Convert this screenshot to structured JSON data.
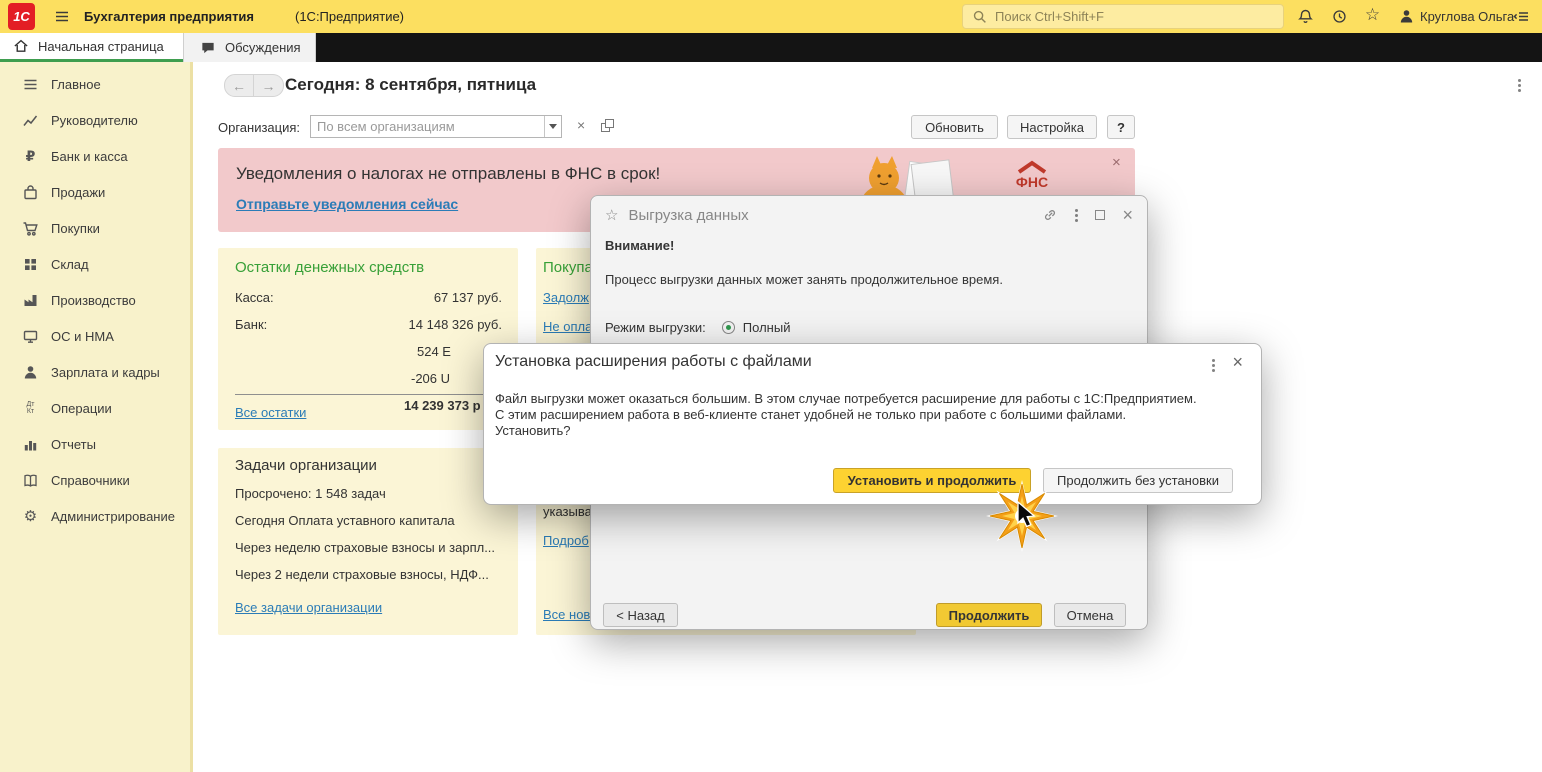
{
  "topbar": {
    "logo": "1С",
    "app_title": "Бухгалтерия предприятия",
    "app_subtitle": "(1С:Предприятие)",
    "search_placeholder": "Поиск Ctrl+Shift+F",
    "user_name": "Круглова Ольга"
  },
  "tabs": {
    "home": "Начальная страница",
    "discussions": "Обсуждения"
  },
  "sidebar": {
    "items": [
      {
        "label": "Главное"
      },
      {
        "label": "Руководителю"
      },
      {
        "label": "Банк и касса"
      },
      {
        "label": "Продажи"
      },
      {
        "label": "Покупки"
      },
      {
        "label": "Склад"
      },
      {
        "label": "Производство"
      },
      {
        "label": "ОС и НМА"
      },
      {
        "label": "Зарплата и кадры"
      },
      {
        "label": "Операции"
      },
      {
        "label": "Отчеты"
      },
      {
        "label": "Справочники"
      },
      {
        "label": "Администрирование"
      }
    ]
  },
  "main": {
    "date_heading": "Сегодня: 8 сентября, пятница",
    "organization": {
      "label": "Организация:",
      "value": "По всем организациям"
    },
    "toolbar": {
      "refresh": "Обновить",
      "settings": "Настройка",
      "help": "?"
    },
    "notification": {
      "title": "Уведомления о налогах не отправлены в ФНС в срок!",
      "link": "Отправьте уведомления сейчас",
      "fns": "ФНС"
    },
    "cash_panel": {
      "title": "Остатки денежных средств",
      "rows": [
        {
          "label": "Касса:",
          "value": "67 137 руб."
        },
        {
          "label": "Банк:",
          "value": "14 148 326 руб."
        },
        {
          "value": "524 E"
        },
        {
          "value": "-206 U"
        }
      ],
      "link": "Все остатки",
      "total": "14 239 373 р"
    },
    "tasks_panel": {
      "title": "Задачи организации",
      "rows": [
        "Просрочено: 1 548 задач",
        "Сегодня Оплата уставного капитала",
        "Через неделю страховые взносы и зарпл...",
        "Через 2 недели страховые взносы, НДФ..."
      ],
      "link": "Все задачи организации"
    },
    "purchases_panel": {
      "title": "Покупа",
      "link1": "Задолж",
      "link2": "Не опла",
      "text1": "указыва",
      "link3": "Подроб",
      "link4": "Все нов"
    }
  },
  "export_dialog": {
    "title": "Выгрузка данных",
    "attention": "Внимание!",
    "message": "Процесс выгрузки данных может занять продолжительное время.",
    "mode_label": "Режим выгрузки:",
    "mode_option": "Полный",
    "back": "< Назад",
    "continue": "Продолжить",
    "cancel": "Отмена"
  },
  "extension_dialog": {
    "title": "Установка расширения работы с файлами",
    "line1": "Файл выгрузки может оказаться большим. В этом случае потребуется расширение для работы с 1С:Предприятием.",
    "line2": "С этим расширением работа в веб-клиенте станет удобней не только при работе с большими файлами.",
    "line3": "Установить?",
    "install": "Установить и продолжить",
    "skip": "Продолжить без установки"
  },
  "icons": {
    "close": "×",
    "star": "☆",
    "gear": "⚙",
    "ruble": "₽",
    "dt": "Дт",
    "kt": "Кт",
    "back_arrow": "←",
    "forward_arrow": "→"
  },
  "colors": {
    "accent_yellow": "#fcdf60",
    "button_yellow": "#fdd231",
    "link_blue": "#2b7cb7",
    "green_title": "#38a038",
    "banner_pink": "#f2c9cb",
    "tab_underline_green": "#3f9e4f"
  }
}
